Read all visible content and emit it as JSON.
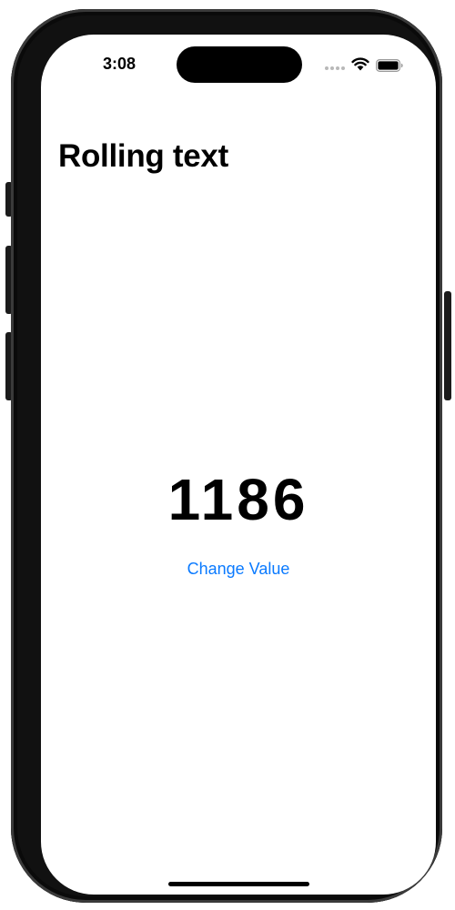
{
  "status_bar": {
    "time": "3:08",
    "icons": [
      "cellular-dots-icon",
      "wifi-icon",
      "battery-icon"
    ]
  },
  "navigation": {
    "title": "Rolling text"
  },
  "main": {
    "value": "1186",
    "change_button_label": "Change Value"
  },
  "colors": {
    "accent": "#0A7AFF",
    "text": "#000000",
    "background": "#FFFFFF",
    "device_frame": "#111111"
  }
}
